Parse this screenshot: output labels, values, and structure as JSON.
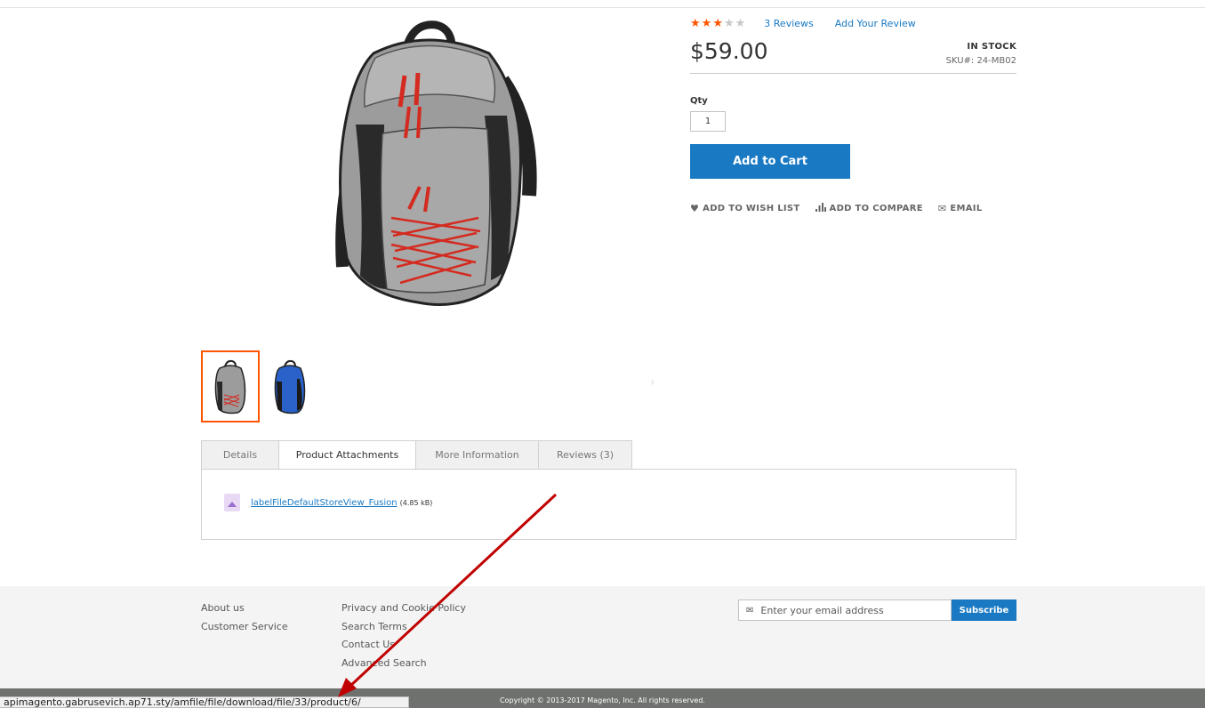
{
  "product": {
    "rating_fraction": 0.6,
    "reviews_link": "3  Reviews",
    "add_review_link": "Add Your Review",
    "price": "$59.00",
    "stock": "IN STOCK",
    "sku": "SKU#:  24-MB02",
    "qty_label": "Qty",
    "qty_value": "1",
    "add_to_cart": "Add to Cart",
    "actions": {
      "wishlist": "ADD TO WISH LIST",
      "compare": "ADD TO COMPARE",
      "email": "EMAIL"
    }
  },
  "tabs": [
    {
      "label": "Details"
    },
    {
      "label": "Product Attachments"
    },
    {
      "label": "More Information"
    },
    {
      "label": "Reviews (3)"
    }
  ],
  "attachment": {
    "name": "labelFileDefaultStoreView_Fusion ",
    "size": "(4.85 kB)"
  },
  "footer": {
    "col1": [
      "About us",
      "Customer Service"
    ],
    "col2": [
      "Privacy and Cookie Policy",
      "Search Terms",
      "Contact Us",
      "Advanced Search"
    ],
    "newsletter_placeholder": "Enter your email address",
    "subscribe": "Subscribe",
    "copyright": "Copyright © 2013-2017 Magento, Inc. All rights reserved."
  },
  "status_bar_url": "apimagento.gabrusevich.ap71.sty/amfile/file/download/file/33/product/6/",
  "colors": {
    "accent": "#1979c3",
    "star": "#ff5501",
    "annotation_arrow": "#c00000"
  },
  "icons": {
    "wishlist": "heart-icon",
    "compare": "bar-chart-icon",
    "email": "envelope-icon",
    "file": "image-file-icon"
  }
}
